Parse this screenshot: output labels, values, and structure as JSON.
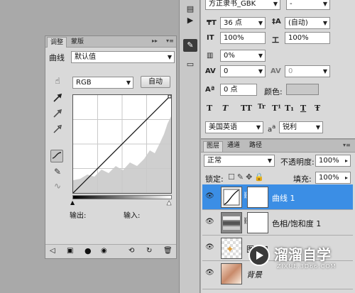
{
  "adjustments": {
    "tabs": [
      "调整",
      "蒙版"
    ],
    "preset_label": "曲线",
    "preset_value": "默认值",
    "channel": "RGB",
    "auto_label": "自动",
    "output_label": "输出:",
    "input_label": "输入:"
  },
  "character": {
    "font_family": "方正隶书_GBK",
    "font_style": "-",
    "font_size": "36 点",
    "leading": "(自动)",
    "vertical_scale": "100%",
    "horizontal_scale": "100%",
    "tsume": "0%",
    "kerning": "0",
    "tracking": "0",
    "baseline_shift": "0 点",
    "color_label": "颜色:",
    "language": "美国英语",
    "aa_prefix": "a",
    "aa_small": "a",
    "anti_alias": "锐利",
    "style_buttons": [
      "T",
      "T",
      "TT",
      "Tr",
      "T¹",
      "T₁",
      "T",
      "Ŧ"
    ]
  },
  "layers": {
    "tabs": [
      "图层",
      "通道",
      "路径"
    ],
    "blend_mode": "正常",
    "opacity_label": "不透明度:",
    "opacity": "100%",
    "lock_label": "锁定:",
    "fill_label": "填充:",
    "fill": "100%",
    "items": [
      {
        "name": "曲线 1"
      },
      {
        "name": "色相/饱和度 1"
      },
      {
        "name": "图层 1"
      },
      {
        "name": "背景"
      }
    ]
  },
  "watermark": {
    "title": "溜溜自学",
    "url": "ZIXUE.3D66.COM"
  },
  "colors": {
    "selection": "#3b8ee5",
    "watermark_bg": "#3a3a3a"
  }
}
